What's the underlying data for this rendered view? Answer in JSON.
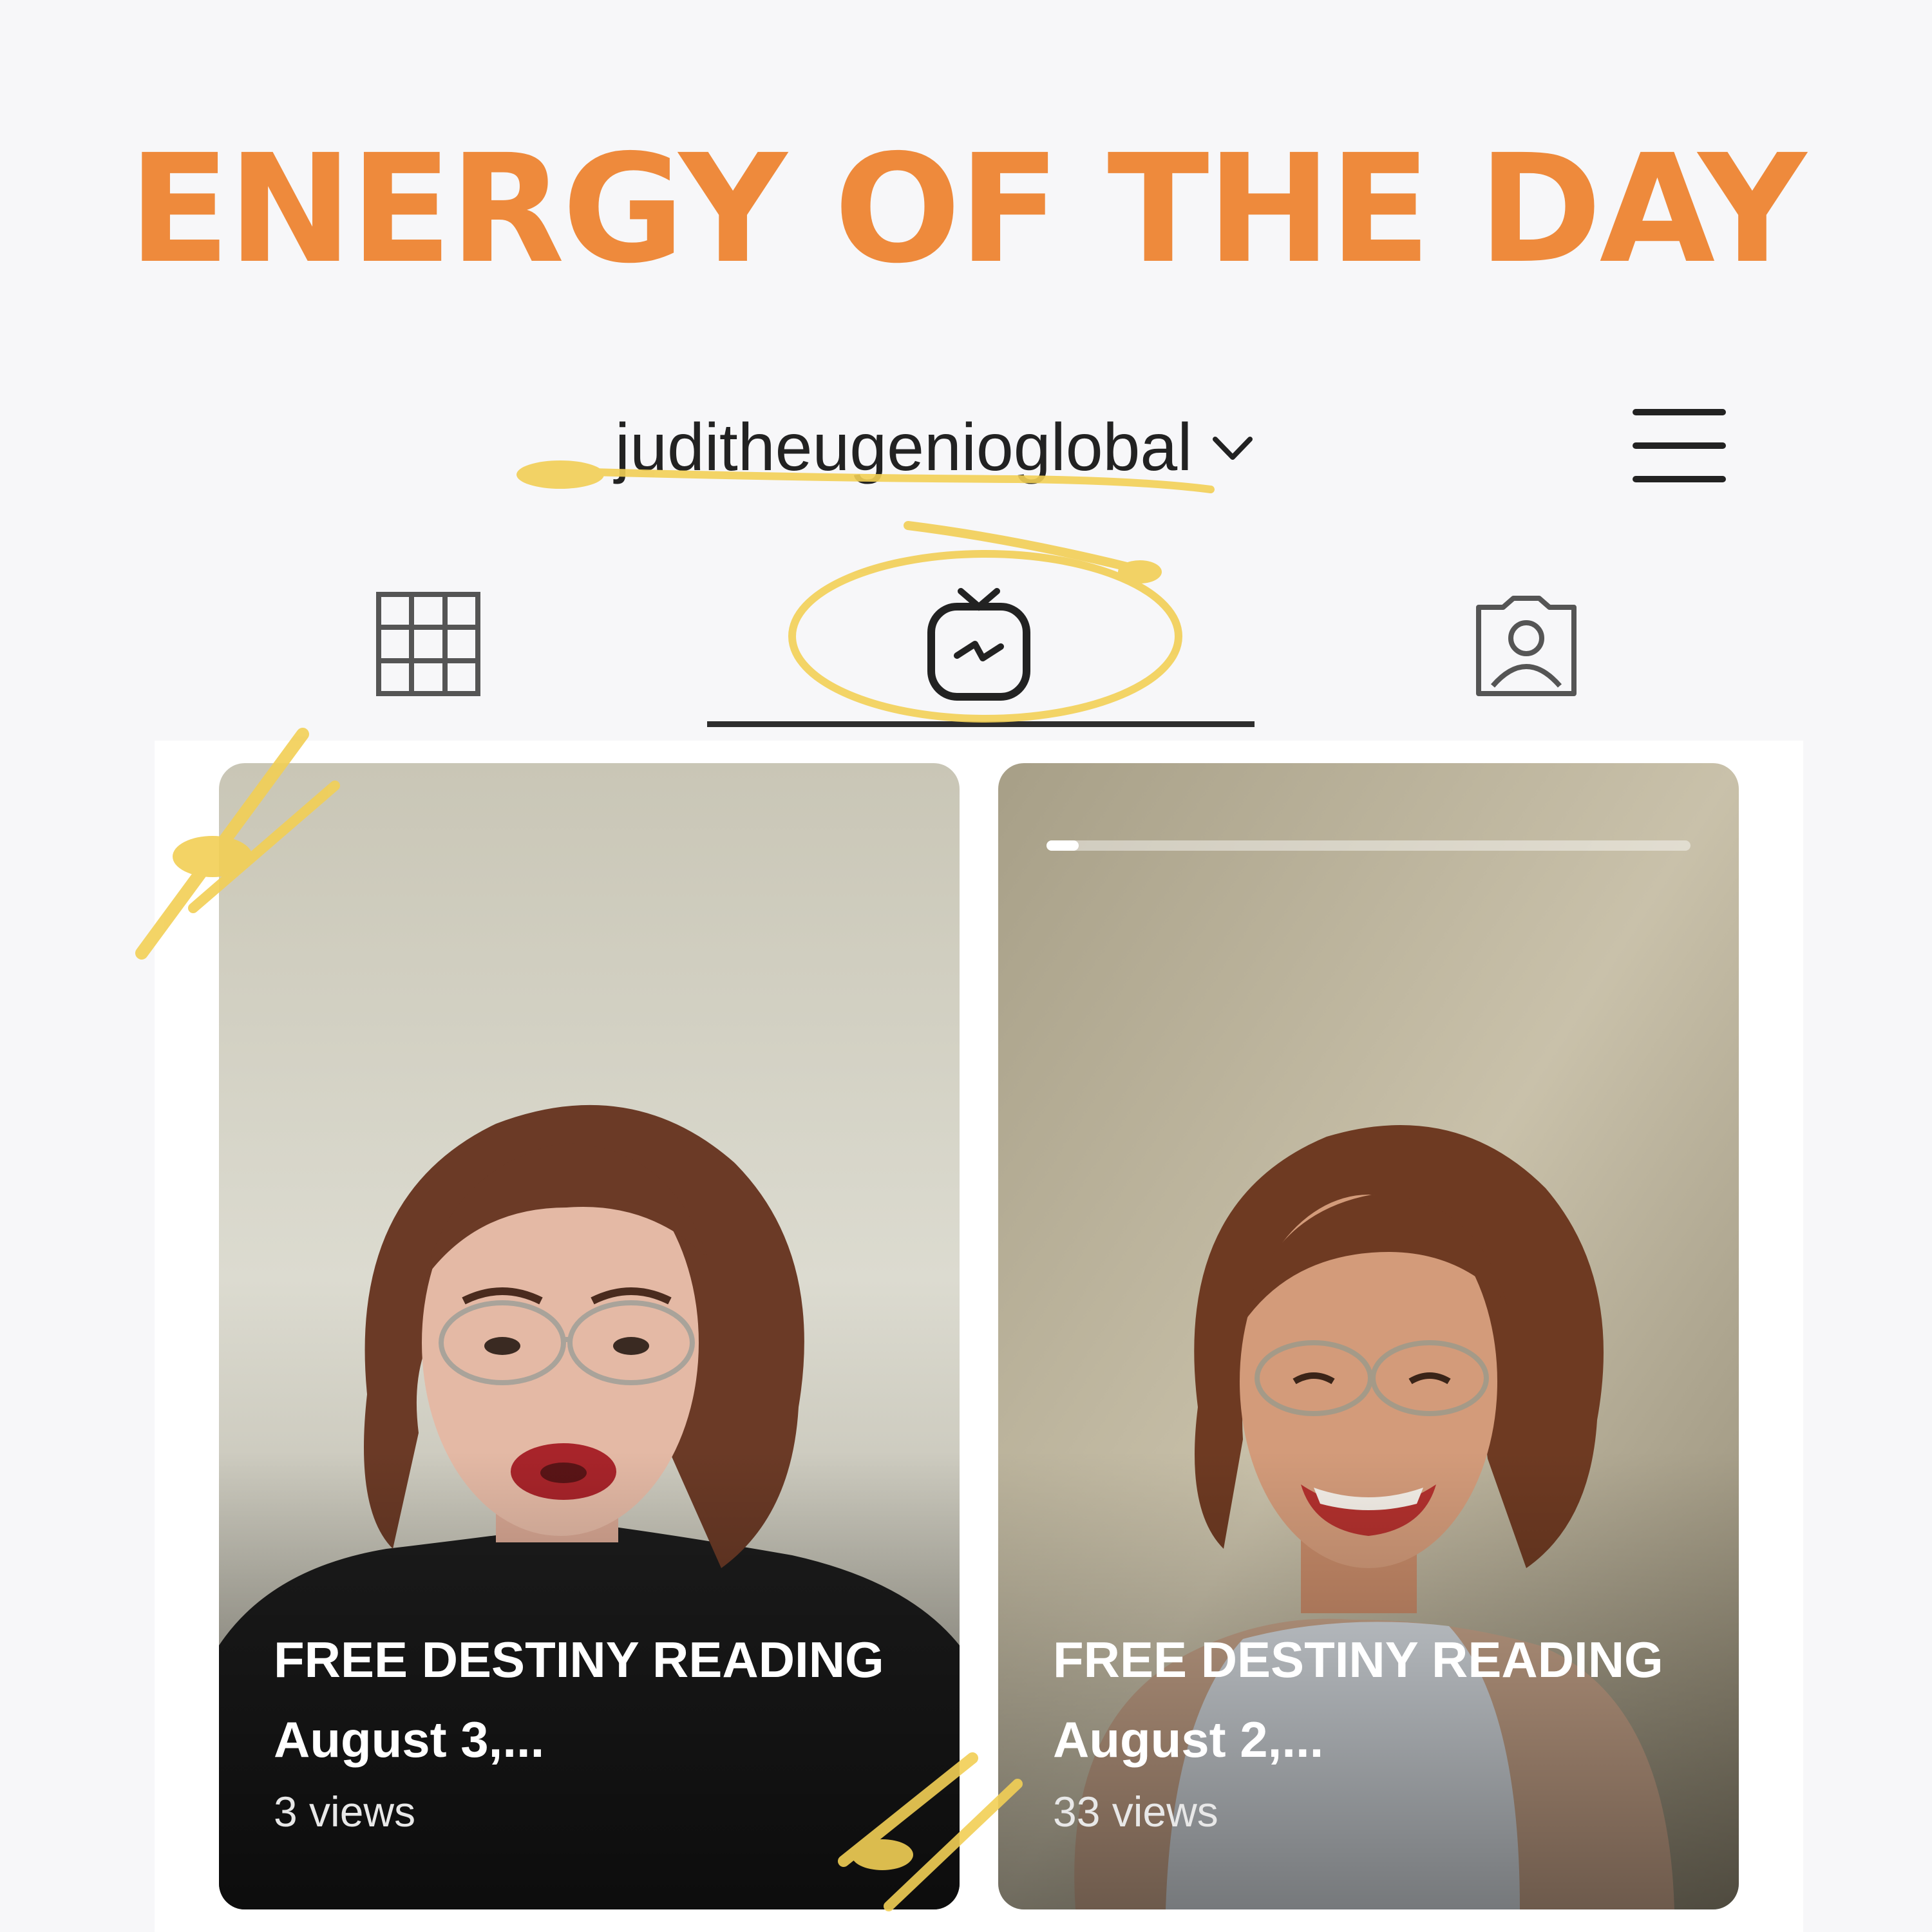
{
  "headline": "ENERGY OF THE DAY",
  "colors": {
    "headline": "#ee8a3c",
    "highlighter": "#f2cf55",
    "text": "#222222",
    "underline": "#2e2e2e"
  },
  "profile": {
    "username": "juditheugenioglobal",
    "username_icon": "chevron-down-icon",
    "menu_icon": "hamburger-menu-icon"
  },
  "tabs": [
    {
      "name": "posts-grid",
      "icon": "grid-icon",
      "active": false
    },
    {
      "name": "igtv",
      "icon": "igtv-icon",
      "active": true
    },
    {
      "name": "tagged",
      "icon": "tagged-person-icon",
      "active": false
    }
  ],
  "videos": [
    {
      "title": "FREE DESTINY READING August 3,...",
      "views": "3 views",
      "progress": 0
    },
    {
      "title": "FREE DESTINY READING August 2,...",
      "views": "33 views",
      "progress": 0.05
    }
  ]
}
